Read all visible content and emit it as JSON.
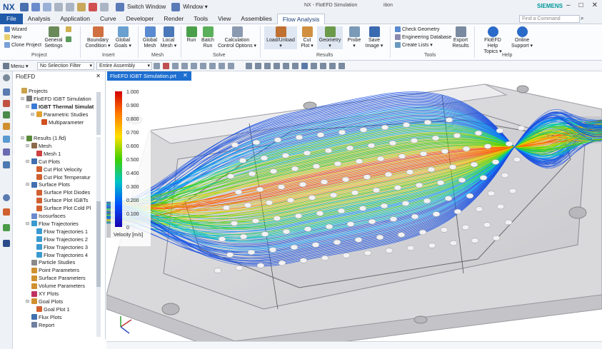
{
  "titlebar": {
    "app": "NX",
    "switch_window": "Switch Window",
    "window": "Window",
    "title": "NX - FloEFD Simulation",
    "title_right": "ition",
    "brand": "SIEMENS"
  },
  "menu": {
    "tabs": [
      "File",
      "Analysis",
      "Application",
      "Curve",
      "Developer",
      "Render",
      "Tools",
      "View",
      "Assemblies",
      "Flow Analysis"
    ],
    "search_placeholder": "Find a Command"
  },
  "ribbon": {
    "wizard": "Wizard",
    "new": "New",
    "clone": "Clone Project",
    "general_settings": [
      "General",
      "Settings"
    ],
    "project_group": "Project",
    "boundary": [
      "Boundary",
      "Condition ▾"
    ],
    "global_goals": [
      "Global",
      "Goals ▾"
    ],
    "insert_group": "Insert",
    "global_mesh": [
      "Global",
      "Mesh"
    ],
    "local_mesh": [
      "Local",
      "Mesh ▾"
    ],
    "mesh_group": "Mesh",
    "run": "Run",
    "batch_run": [
      "Batch",
      "Run"
    ],
    "calc_control": [
      "Calculation",
      "Control Options ▾"
    ],
    "solve_group": "Solve",
    "load_unload": "Load/Unload",
    "cut_plot": [
      "Cut",
      "Plot ▾"
    ],
    "geometry": [
      "Geometry",
      "▾"
    ],
    "probe": [
      "Probe",
      "▾"
    ],
    "save_image": [
      "Save",
      "Image ▾"
    ],
    "results_group": "Results",
    "check_geometry": "Check Geometry",
    "engineering_db": "Engineering Database",
    "create_lists": "Create Lists ▾",
    "export_results": [
      "Export",
      "Results"
    ],
    "tools_group": "Tools",
    "help_topics": [
      "FloEFD Help",
      "Topics ▾"
    ],
    "online_support": [
      "Online",
      "Support ▾"
    ],
    "help_group": "Help"
  },
  "toolbar2": {
    "menu": "Menu ▾",
    "selection_filter": "No Selection Filter",
    "assembly": "Entire Assembly"
  },
  "nav": {
    "title": "FloEFD",
    "items": [
      {
        "label": "Projects",
        "indent": 0,
        "exp": "",
        "color": "#caa24a"
      },
      {
        "label": "FloEFD IGBT Simulation",
        "indent": 1,
        "exp": "⊟",
        "color": "#7a7a7a"
      },
      {
        "label": "IGBT Thermal Simulat",
        "indent": 2,
        "exp": "⊟",
        "color": "#3a7bd5",
        "bold": true
      },
      {
        "label": "Parametric Studies",
        "indent": 3,
        "exp": "⊟",
        "color": "#e0a030"
      },
      {
        "label": "Multiparameter",
        "indent": 4,
        "exp": "",
        "color": "#d05020"
      },
      {
        "label": "Results (1.fld)",
        "indent": 1,
        "exp": "⊟",
        "color": "#5a8a3a"
      },
      {
        "label": "Mesh",
        "indent": 2,
        "exp": "⊟",
        "color": "#8a6a4a"
      },
      {
        "label": "Mesh 1",
        "indent": 3,
        "exp": "",
        "color": "#d04040"
      },
      {
        "label": "Cut Plots",
        "indent": 2,
        "exp": "⊟",
        "color": "#4070b0"
      },
      {
        "label": "Cut Plot Velocity",
        "indent": 3,
        "exp": "",
        "color": "#d06030"
      },
      {
        "label": "Cut Plot Temperatur",
        "indent": 3,
        "exp": "",
        "color": "#d06030"
      },
      {
        "label": "Surface Plots",
        "indent": 2,
        "exp": "⊟",
        "color": "#4070b0"
      },
      {
        "label": "Surface Plot Diodes",
        "indent": 3,
        "exp": "",
        "color": "#d06030"
      },
      {
        "label": "Surface Plot IGBTs",
        "indent": 3,
        "exp": "",
        "color": "#d06030"
      },
      {
        "label": "Surface Plot Cold Pl",
        "indent": 3,
        "exp": "",
        "color": "#d06030"
      },
      {
        "label": "Isosurfaces",
        "indent": 2,
        "exp": "",
        "color": "#6a8ad0"
      },
      {
        "label": "Flow Trajectories",
        "indent": 2,
        "exp": "⊟",
        "color": "#3a9ad0"
      },
      {
        "label": "Flow Trajectories 1",
        "indent": 3,
        "exp": "",
        "color": "#3a9ad0"
      },
      {
        "label": "Flow Trajectories 2",
        "indent": 3,
        "exp": "",
        "color": "#3a9ad0"
      },
      {
        "label": "Flow Trajectories 3",
        "indent": 3,
        "exp": "",
        "color": "#3a9ad0"
      },
      {
        "label": "Flow Trajectories 4",
        "indent": 3,
        "exp": "",
        "color": "#3a9ad0"
      },
      {
        "label": "Particle Studies",
        "indent": 2,
        "exp": "",
        "color": "#8a8a8a"
      },
      {
        "label": "Point Parameters",
        "indent": 2,
        "exp": "",
        "color": "#d09030"
      },
      {
        "label": "Surface Parameters",
        "indent": 2,
        "exp": "",
        "color": "#d09030"
      },
      {
        "label": "Volume Parameters",
        "indent": 2,
        "exp": "",
        "color": "#d09030"
      },
      {
        "label": "XY Plots",
        "indent": 2,
        "exp": "",
        "color": "#c03060"
      },
      {
        "label": "Goal Plots",
        "indent": 2,
        "exp": "⊟",
        "color": "#d09030"
      },
      {
        "label": "Goal Plot 1",
        "indent": 3,
        "exp": "",
        "color": "#d06030"
      },
      {
        "label": "Flux Plots",
        "indent": 2,
        "exp": "",
        "color": "#4070b0"
      },
      {
        "label": "Report",
        "indent": 2,
        "exp": "",
        "color": "#7080a0"
      }
    ]
  },
  "viewport": {
    "tab": "FloEFD IGBT Simulation.prt",
    "legend_values": [
      "1.000",
      "0.900",
      "0.800",
      "0.700",
      "0.600",
      "0.500",
      "0.400",
      "0.300",
      "0.200",
      "0.100",
      "0"
    ],
    "legend_title": "Velocity [m/s]"
  }
}
